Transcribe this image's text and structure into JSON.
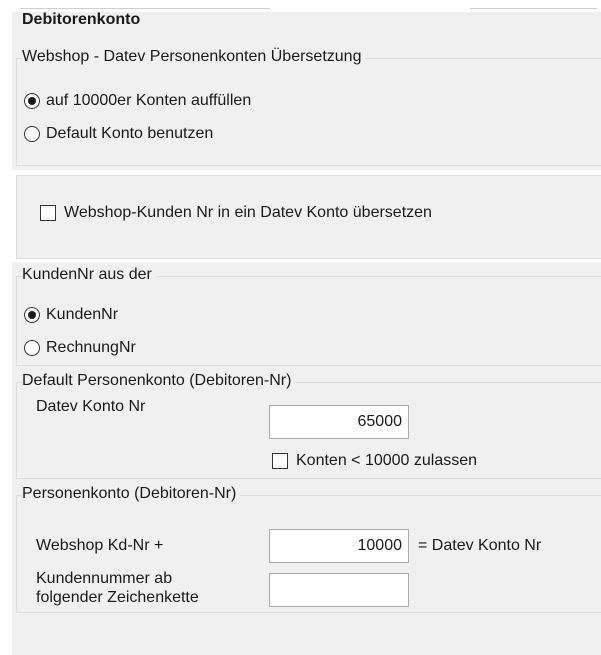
{
  "debitorenkonto": {
    "title": "Debitorenkonto",
    "group_title": "Webshop - Datev Personenkonten Übersetzung",
    "options": [
      {
        "label": "auf 10000er Konten auffüllen",
        "selected": true
      },
      {
        "label": "Default Konto benutzen",
        "selected": false
      }
    ]
  },
  "translate_checkbox": {
    "label": "Webshop-Kunden Nr in ein Datev Konto übersetzen",
    "checked": false
  },
  "kundennr_source": {
    "title": "KundenNr aus der",
    "options": [
      {
        "label": "KundenNr",
        "selected": true
      },
      {
        "label": "RechnungNr",
        "selected": false
      }
    ]
  },
  "default_personenkonto": {
    "title": "Default Personenkonto (Debitoren-Nr)",
    "field_label": "Datev Konto Nr",
    "field_value": "65000",
    "allow_checkbox": {
      "label": "Konten < 10000 zulassen",
      "checked": false
    }
  },
  "personenkonto": {
    "title": "Personenkonto (Debitoren-Nr)",
    "webshop_label": "Webshop Kd-Nr +",
    "webshop_value": "10000",
    "suffix": "= Datev Konto Nr",
    "kundennummer_label_line1": "Kundennummer ab",
    "kundennummer_label_line2": "folgender Zeichenkette",
    "kundennummer_value": ""
  }
}
